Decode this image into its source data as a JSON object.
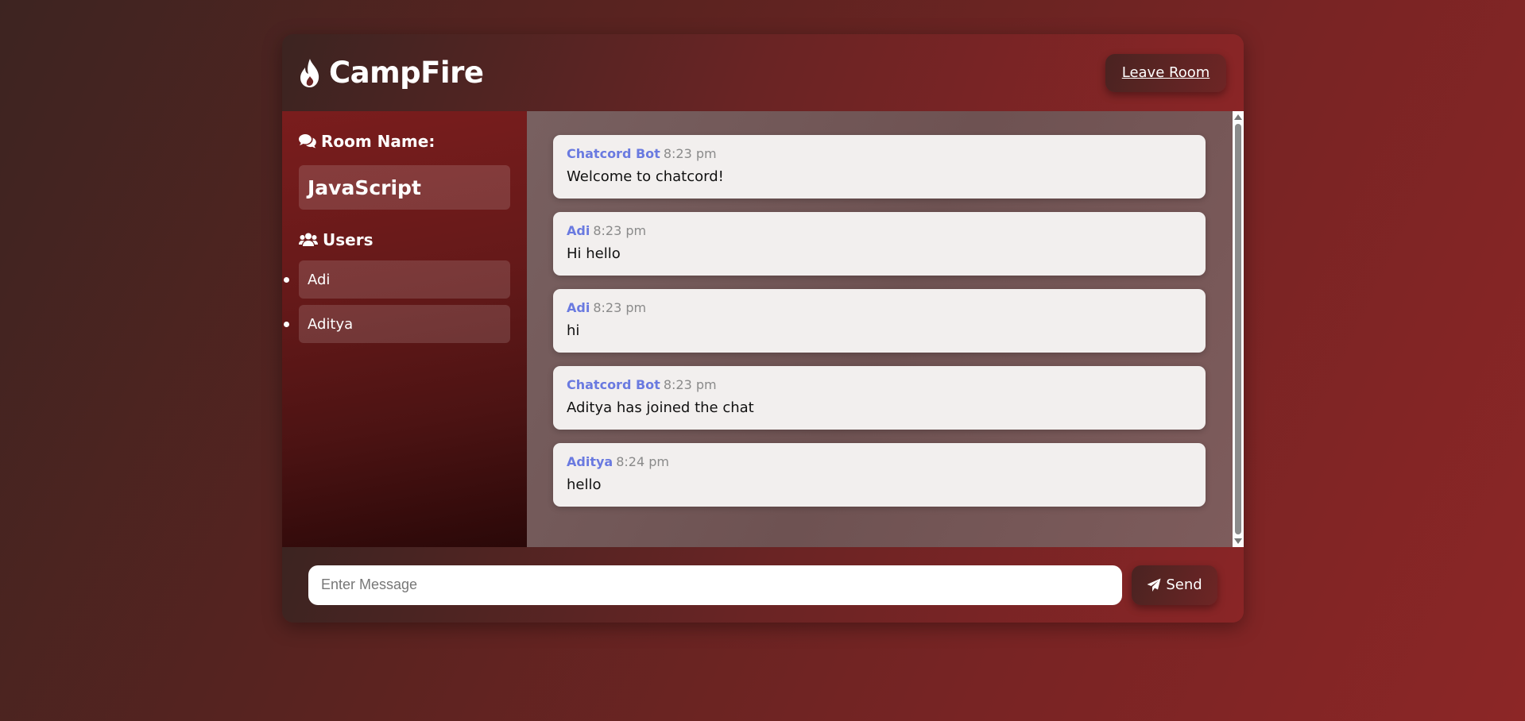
{
  "header": {
    "logo_text": "CampFire",
    "logo_icon": "fire-icon",
    "leave_label": "Leave Room"
  },
  "sidebar": {
    "room_heading": "Room Name:",
    "room_icon": "comments-icon",
    "room_name": "JavaScript",
    "users_heading": "Users",
    "users_icon": "users-icon",
    "users": [
      {
        "name": "Adi"
      },
      {
        "name": "Aditya"
      }
    ]
  },
  "messages": [
    {
      "user": "Chatcord Bot",
      "time": "8:23 pm",
      "text": "Welcome to chatcord!"
    },
    {
      "user": "Adi",
      "time": "8:23 pm",
      "text": "Hi hello"
    },
    {
      "user": "Adi",
      "time": "8:23 pm",
      "text": "hi"
    },
    {
      "user": "Chatcord Bot",
      "time": "8:23 pm",
      "text": "Aditya has joined the chat"
    },
    {
      "user": "Aditya",
      "time": "8:24 pm",
      "text": "hello"
    }
  ],
  "form": {
    "placeholder": "Enter Message",
    "value": "",
    "send_label": "Send",
    "send_icon": "paper-plane-icon"
  },
  "colors": {
    "username": "#6a7ae0",
    "accent": "#8a2526"
  }
}
